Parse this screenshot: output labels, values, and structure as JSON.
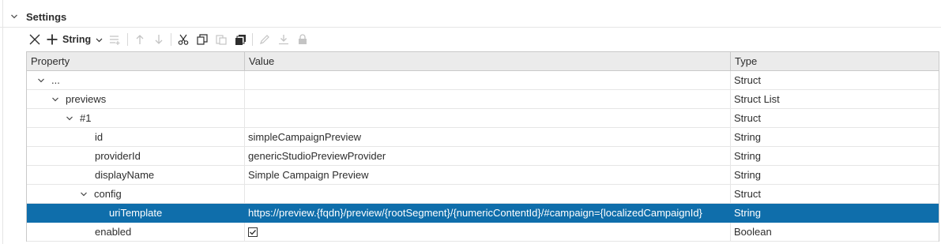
{
  "section": {
    "title": "Settings"
  },
  "toolbar": {
    "add_label": "String",
    "icons": [
      "close-icon",
      "add-icon",
      "chevron-down-icon",
      "insert-list-icon",
      "move-up-icon",
      "move-down-icon",
      "cut-icon",
      "copy-icon",
      "paste-icon",
      "duplicate-icon",
      "edit-icon",
      "download-icon",
      "lock-icon"
    ]
  },
  "grid": {
    "columns": {
      "property": "Property",
      "value": "Value",
      "type": "Type"
    },
    "rows": [
      {
        "property": "...",
        "value": "",
        "type": "Struct"
      },
      {
        "property": "previews",
        "value": "",
        "type": "Struct List"
      },
      {
        "property": "#1",
        "value": "",
        "type": "Struct"
      },
      {
        "property": "id",
        "value": "simpleCampaignPreview",
        "type": "String"
      },
      {
        "property": "providerId",
        "value": "genericStudioPreviewProvider",
        "type": "String"
      },
      {
        "property": "displayName",
        "value": "Simple Campaign Preview",
        "type": "String"
      },
      {
        "property": "config",
        "value": "",
        "type": "Struct"
      },
      {
        "property": "uriTemplate",
        "value": "https://preview.{fqdn}/preview/{rootSegment}/{numericContentId}/#campaign={localizedCampaignId}",
        "type": "String",
        "selected": true
      },
      {
        "property": "enabled",
        "value": "",
        "checked": true,
        "type": "Boolean"
      }
    ]
  },
  "colors": {
    "selection": "#0f6eab",
    "header_bg": "#ebebeb"
  }
}
